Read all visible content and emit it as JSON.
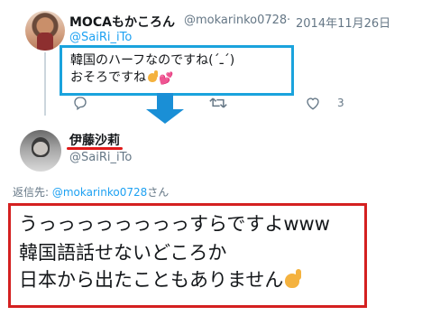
{
  "tweet1": {
    "display_name": "MOCAもかころん",
    "handle": "@mokarinko0728",
    "separator": "·",
    "date": "2014年11月26日",
    "reply_to": "@SaiRi_iTo",
    "text_line1": "韓国のハーフなのですね(΄ـ΄)",
    "text_line2": "おそろですね",
    "like_count": "3",
    "icons": [
      "reply-icon",
      "retweet-icon",
      "like-icon"
    ]
  },
  "tweet2": {
    "display_name": "伊藤沙莉",
    "handle": "@SaiRi_iTo",
    "reply_prefix": "返信先: ",
    "reply_mention": "@mokarinko0728",
    "reply_suffix": "さん",
    "text_line1": "うっっっっっっっっすらですよwww",
    "text_line2": "韓国語話せないどころか",
    "text_line3": "日本から出たこともありません"
  },
  "colors": {
    "blue_highlight": "#1aa3dd",
    "red_highlight": "#d42020",
    "arrow": "#1a8fd6",
    "link": "#1da1f2",
    "muted": "#657786"
  }
}
